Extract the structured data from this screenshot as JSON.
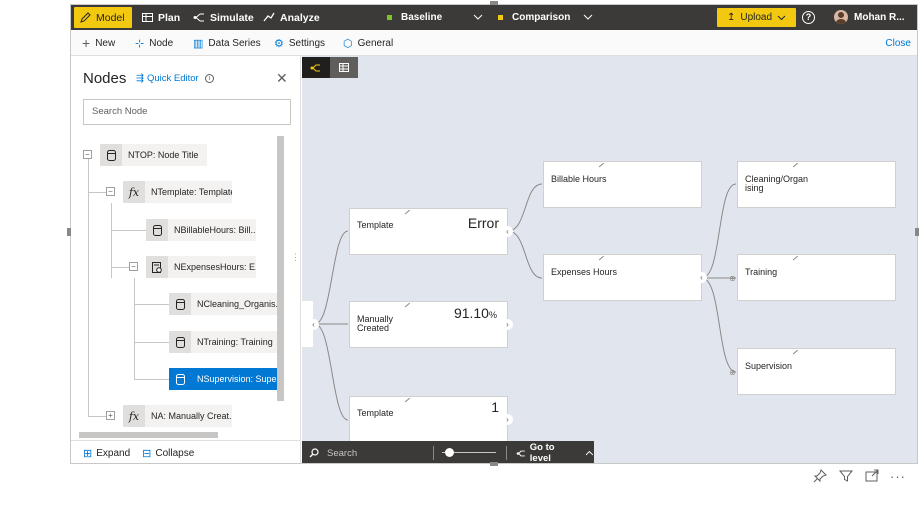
{
  "topbar": {
    "tabs": [
      {
        "label": "Model",
        "icon": "pencil-icon"
      },
      {
        "label": "Plan",
        "icon": "table-icon"
      },
      {
        "label": "Simulate",
        "icon": "simulate-icon"
      },
      {
        "label": "Analyze",
        "icon": "analyze-icon"
      }
    ],
    "baseline_label": "Baseline",
    "baseline_color": "#7cc427",
    "comparison_label": "Comparison",
    "comparison_color": "#f2c811",
    "upload_label": "Upload",
    "user_name": "Mohan R..."
  },
  "toolbar": {
    "items": [
      "New",
      "Node",
      "Data Series",
      "Settings",
      "General"
    ],
    "close_label": "Close"
  },
  "nodes_panel": {
    "title": "Nodes",
    "quick_editor_label": "Quick Editor",
    "search_placeholder": "Search Node",
    "tree": [
      {
        "label": "NTOP: Node Title",
        "icon": "database-icon"
      },
      {
        "label": "NTemplate: Template",
        "icon": "function-icon"
      },
      {
        "label": "NBillableHours: Bill...",
        "icon": "database-icon"
      },
      {
        "label": "NExpensesHours: E...",
        "icon": "calculator-icon"
      },
      {
        "label": "NCleaning_Organis...",
        "icon": "database-icon"
      },
      {
        "label": "NTraining: Training",
        "icon": "database-icon"
      },
      {
        "label": "NSupervision: Supe...",
        "icon": "database-icon",
        "selected": true
      },
      {
        "label": "NA: Manually Creat...",
        "icon": "function-icon"
      }
    ],
    "expand_label": "Expand",
    "collapse_label": "Collapse"
  },
  "canvas": {
    "cards": [
      {
        "label": "Template",
        "value": "Error"
      },
      {
        "label": "Manually\nCreated",
        "value": "91.10",
        "unit": "%"
      },
      {
        "label": "Template",
        "value": "1"
      },
      {
        "label": "Billable Hours",
        "value": ""
      },
      {
        "label": "Expenses Hours",
        "value": ""
      },
      {
        "label": "Cleaning/Organ\nising",
        "value": ""
      },
      {
        "label": "Training",
        "value": ""
      },
      {
        "label": "Supervision",
        "value": ""
      }
    ],
    "search_label": "Search",
    "go_to_level_label": "Go to level"
  }
}
